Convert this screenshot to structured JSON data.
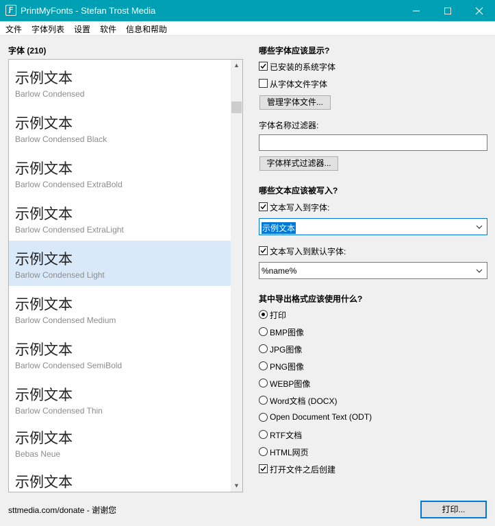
{
  "window": {
    "title": "PrintMyFonts - Stefan Trost Media",
    "app_icon_glyph": "Ƒ"
  },
  "menu": [
    "文件",
    "字体列表",
    "设置",
    "软件",
    "信息和帮助"
  ],
  "font_list": {
    "header": "字体 (210)",
    "sample_text": "示例文本",
    "items": [
      {
        "name": "Barlow Condensed",
        "selected": false
      },
      {
        "name": "Barlow Condensed Black",
        "selected": false
      },
      {
        "name": "Barlow Condensed ExtraBold",
        "selected": false
      },
      {
        "name": "Barlow Condensed ExtraLight",
        "selected": false
      },
      {
        "name": "Barlow Condensed Light",
        "selected": true
      },
      {
        "name": "Barlow Condensed Medium",
        "selected": false
      },
      {
        "name": "Barlow Condensed SemiBold",
        "selected": false
      },
      {
        "name": "Barlow Condensed Thin",
        "selected": false
      },
      {
        "name": "Bebas Neue",
        "selected": false
      },
      {
        "name": "",
        "selected": false
      }
    ]
  },
  "which_fonts": {
    "heading": "哪些字体应该显示?",
    "installed": {
      "label": "已安装的系统字体",
      "checked": true
    },
    "from_files": {
      "label": "从字体文件字体",
      "checked": false
    },
    "manage_button": "管理字体文件...",
    "name_filter_label": "字体名称过滤器:",
    "name_filter_value": "",
    "style_filter_button": "字体样式过滤器..."
  },
  "which_text": {
    "heading": "哪些文本应该被写入?",
    "text_to_font": {
      "label": "文本写入到字体:",
      "checked": true
    },
    "text_to_font_value": "示例文本",
    "text_to_default": {
      "label": "文本写入到默认字体:",
      "checked": true
    },
    "text_to_default_value": "%name%"
  },
  "export": {
    "heading": "其中导出格式应该使用什么?",
    "options": [
      {
        "label": "打印",
        "selected": true
      },
      {
        "label": "BMP图像",
        "selected": false
      },
      {
        "label": "JPG图像",
        "selected": false
      },
      {
        "label": "PNG图像",
        "selected": false
      },
      {
        "label": "WEBP图像",
        "selected": false
      },
      {
        "label": "Word文档 (DOCX)",
        "selected": false
      },
      {
        "label": "Open Document Text (ODT)",
        "selected": false
      },
      {
        "label": "RTF文档",
        "selected": false
      },
      {
        "label": "HTML网页",
        "selected": false
      }
    ],
    "open_after": {
      "label": "打开文件之后创建",
      "checked": true
    }
  },
  "footer": {
    "link_text": "sttmedia.com/donate - 谢谢您",
    "print_button": "打印..."
  }
}
